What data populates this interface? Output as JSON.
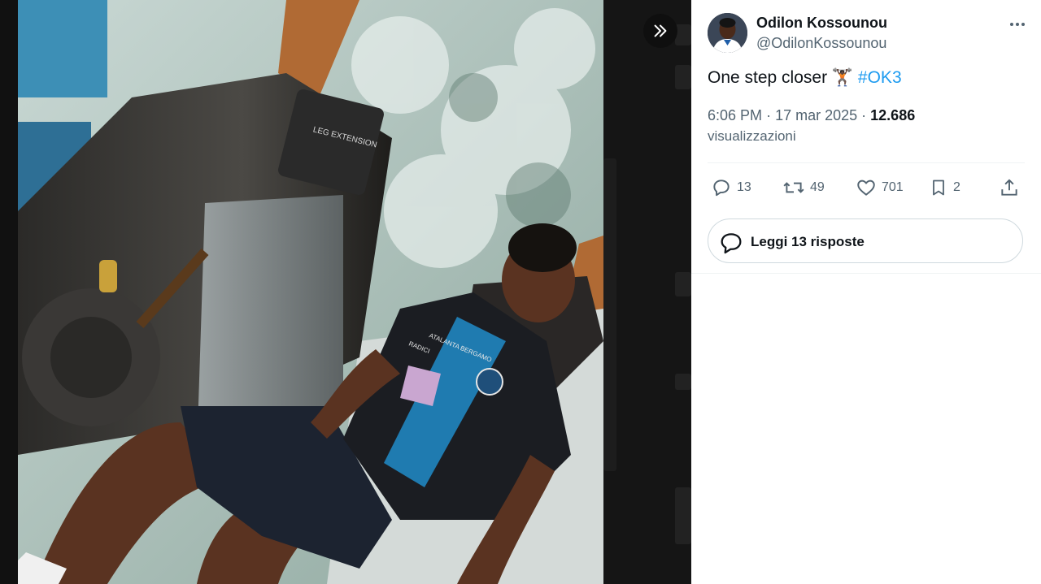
{
  "tweet": {
    "author_name": "Odilon Kossounou",
    "author_handle": "@OdilonKossounou",
    "text": "One step closer",
    "emoji": "🏋🏿",
    "hashtag": "#OK3",
    "time": "6:06 PM",
    "date": "17 mar 2025",
    "views_count": "12.686",
    "views_label": "visualizzazioni"
  },
  "actions": {
    "replies": "13",
    "reposts": "49",
    "likes": "701",
    "bookmarks": "2"
  },
  "read_replies_label": "Leggi 13 risposte",
  "photo": {
    "machine_label": "LEG EXTENSION",
    "shirt_text": "ATALANTA BERGAMO",
    "sponsor": "RADICI"
  },
  "icons": {
    "expand": "double-chevron-right-icon",
    "more": "more-horizontal-icon",
    "reply": "reply-icon",
    "repost": "repost-icon",
    "like": "heart-icon",
    "bookmark": "bookmark-icon",
    "share": "share-icon",
    "read_replies": "speech-bubble-icon"
  },
  "colors": {
    "accent": "#1d9bf0",
    "text": "#0f1419",
    "muted": "#536471"
  }
}
